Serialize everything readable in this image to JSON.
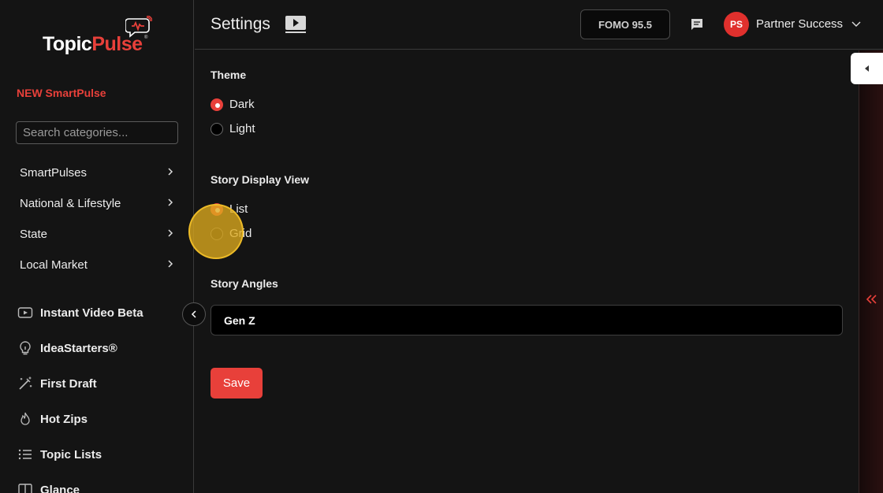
{
  "brand": {
    "logo_part1": "Topic",
    "logo_part2": "Pulse",
    "registered": "®"
  },
  "sidebar": {
    "new_link": "NEW SmartPulse",
    "search_placeholder": "Search categories...",
    "categories": [
      {
        "label": "SmartPulses"
      },
      {
        "label": "National & Lifestyle"
      },
      {
        "label": "State"
      },
      {
        "label": "Local Market"
      }
    ],
    "tools": [
      {
        "label": "Instant Video Beta",
        "icon": "video-icon"
      },
      {
        "label": "IdeaStarters®",
        "icon": "lightbulb-icon"
      },
      {
        "label": "First Draft",
        "icon": "magic-wand-icon"
      },
      {
        "label": "Hot Zips",
        "icon": "flame-icon"
      },
      {
        "label": "Topic Lists",
        "icon": "list-icon"
      },
      {
        "label": "Glance",
        "icon": "book-icon"
      }
    ]
  },
  "header": {
    "title": "Settings",
    "station": "FOMO 95.5",
    "user_initials": "PS",
    "user_name": "Partner Success"
  },
  "settings": {
    "theme": {
      "title": "Theme",
      "options": [
        "Dark",
        "Light"
      ],
      "selected": "Dark"
    },
    "display_view": {
      "title": "Story Display View",
      "options": [
        "List",
        "Grid"
      ],
      "selected": "List"
    },
    "angles": {
      "title": "Story Angles",
      "value": "Gen Z"
    },
    "save_label": "Save"
  },
  "colors": {
    "accent": "#e8403a",
    "background": "#141414",
    "click_marker": "#deaa1e"
  }
}
